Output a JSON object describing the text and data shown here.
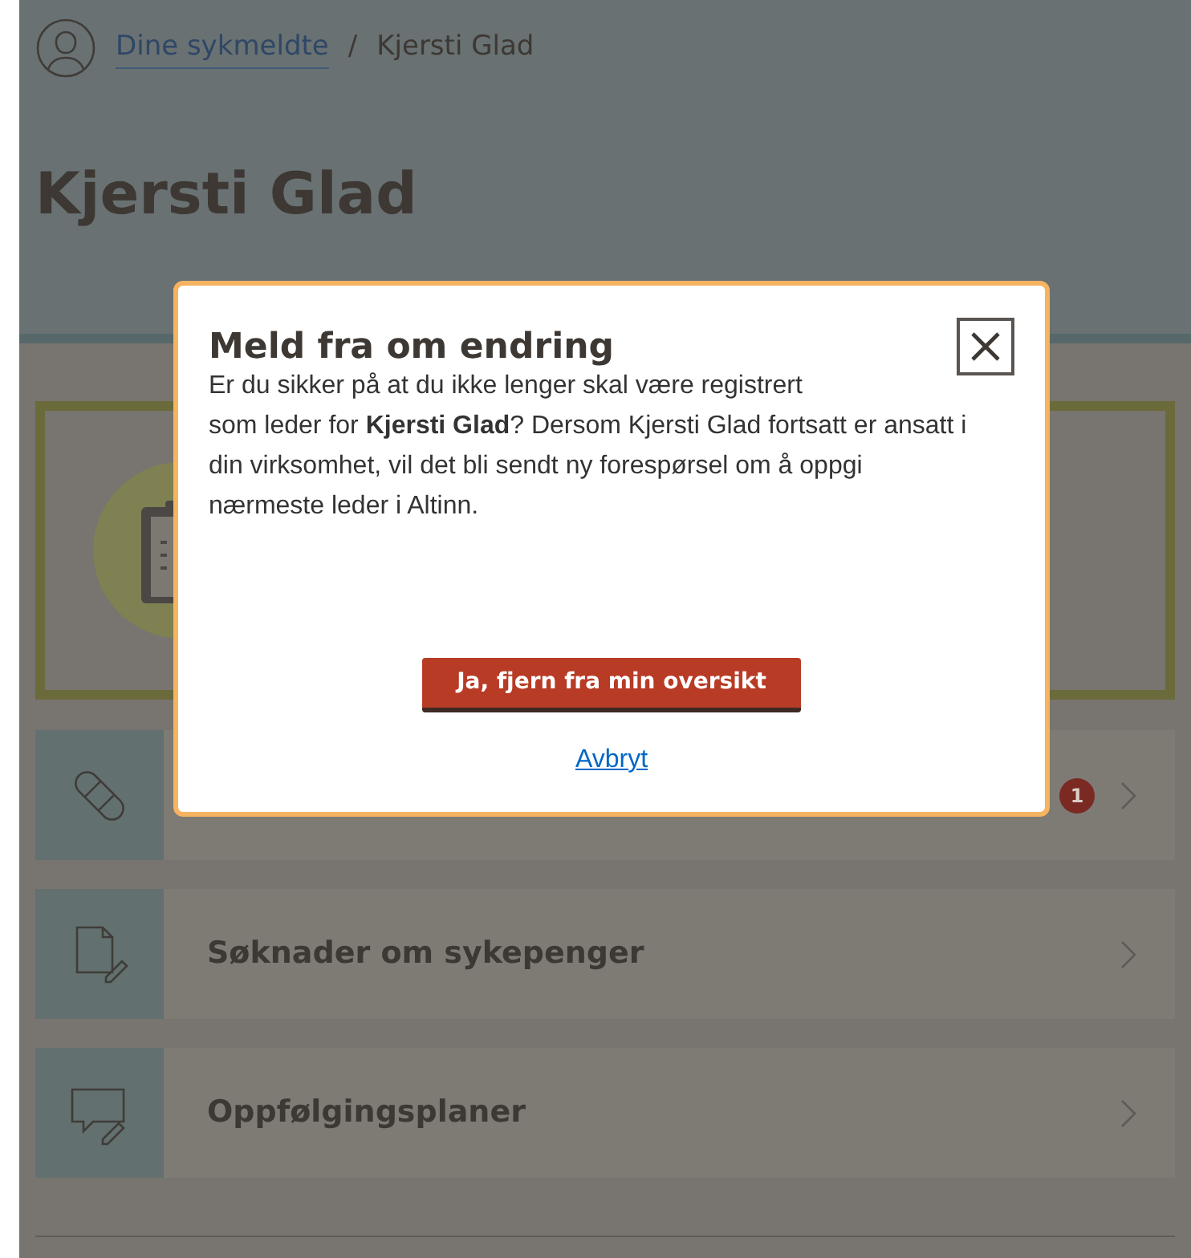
{
  "breadcrumb": [
    {
      "label": "Dine sykmeldte",
      "kind": "link"
    },
    {
      "label": "/",
      "kind": "separator"
    },
    {
      "label": "Kjersti Glad",
      "kind": "current"
    }
  ],
  "title": "Kjersti Glad",
  "nav_items": [
    {
      "kind": "bandage",
      "badge": "1"
    },
    {
      "kind": "document",
      "label": "Søknader om sykepenger"
    },
    {
      "kind": "chat",
      "label": "Oppfølgingsplaner"
    }
  ],
  "modal": {
    "title": "Meld fra om endring",
    "body": "Er du sikker på at du ikke lenger skal være registrert\nsom leder for **Kjersti Glad**? Dersom Kjersti Glad fortsatt er ansatt i din virksomhet, vil det bli sendt ny forespørsel om å oppgi nærmeste leder i Altinn.",
    "confirm_button": "Ja, fjern fra min oversikt",
    "cancel_link": "Avbryt"
  }
}
